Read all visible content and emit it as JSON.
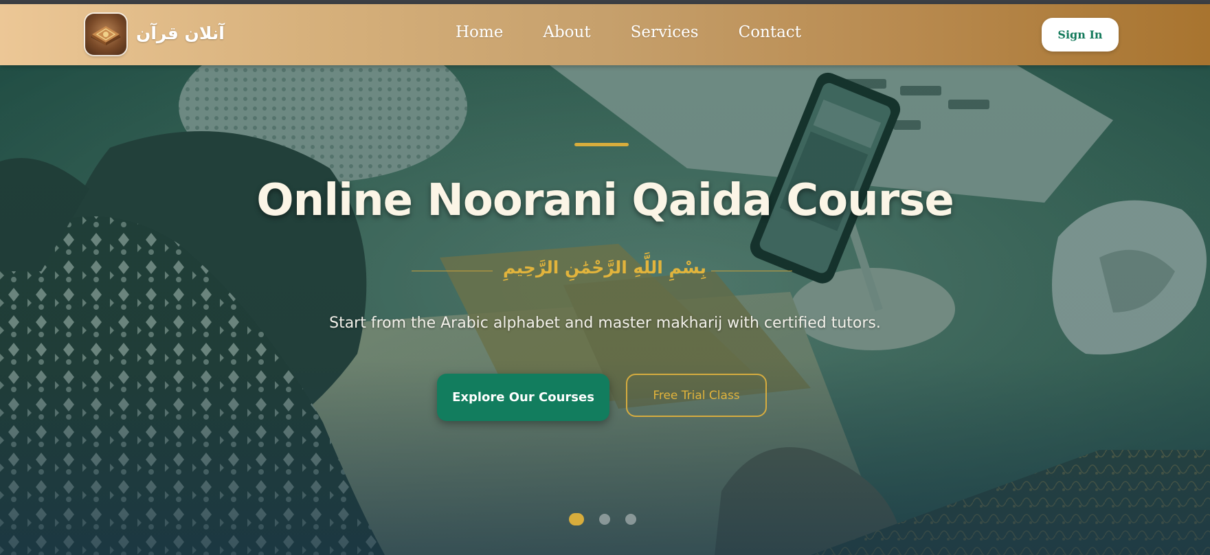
{
  "header": {
    "brand": "آنلان قرآن",
    "nav": [
      "Home",
      "About",
      "Services",
      "Contact"
    ],
    "signin_label": "Sign In"
  },
  "hero": {
    "title": "Online Noorani Qaida Course",
    "basmala": "بِسْمِ اللَّهِ الرَّحْمَٰنِ الرَّحِيمِ",
    "subtitle": "Start from the Arabic alphabet and master makharij with certified tutors.",
    "primary_button": "Explore Our Courses",
    "secondary_button": "Free Trial Class",
    "slides_total": 3,
    "active_slide": 1
  },
  "colors": {
    "header_gradient_start": "#ecc796",
    "header_gradient_end": "#a8742f",
    "primary": "#127d5e",
    "gold": "#d8ad3c",
    "title_text": "#fbf5e6"
  },
  "icons": {
    "logo": "quran-book-icon"
  }
}
